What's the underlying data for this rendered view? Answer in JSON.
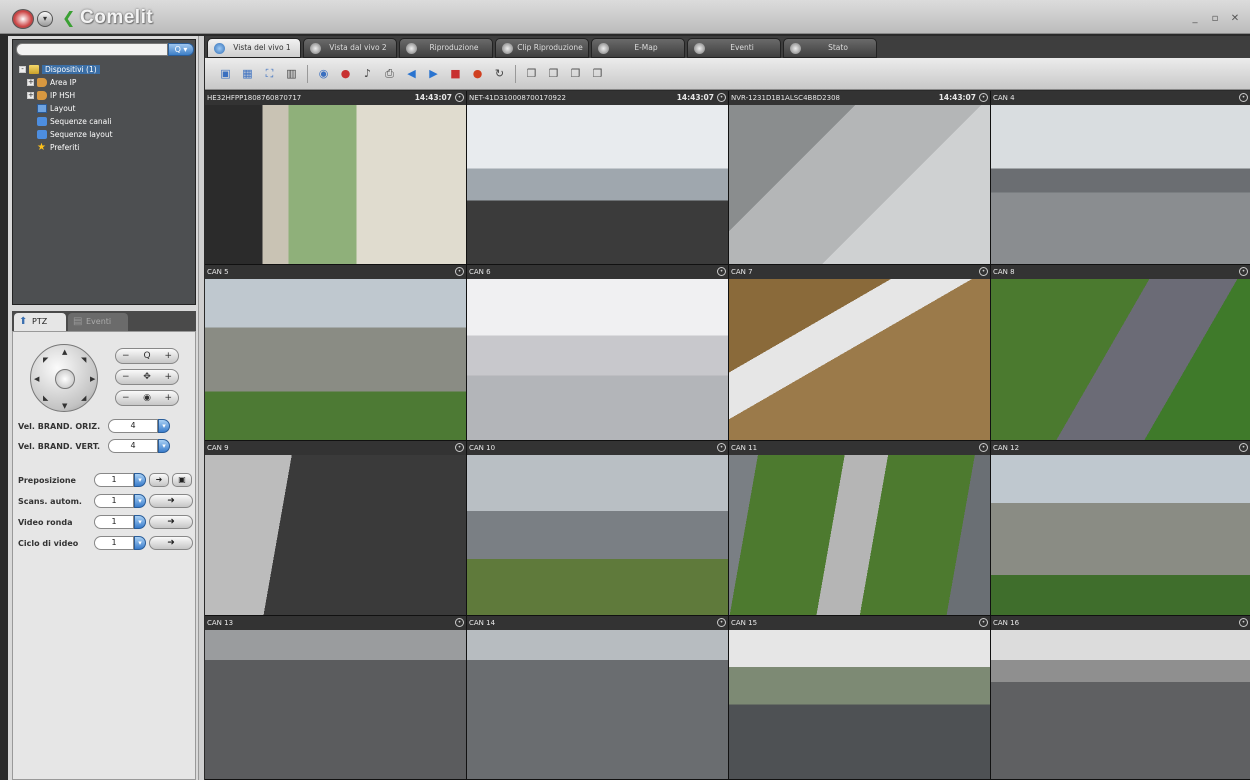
{
  "window": {
    "brand": "Comelit",
    "controls": [
      "_",
      "▫",
      "✕"
    ]
  },
  "search": {
    "placeholder": "",
    "button_label": "Q ▾"
  },
  "tree": [
    {
      "label": "Dispositivi (1)",
      "icon": "folder-icon",
      "expander": "-",
      "selected": true
    },
    {
      "label": "Area IP",
      "icon": "camera-icon",
      "expander": "+",
      "selected": false
    },
    {
      "label": "IP HSH",
      "icon": "camera-icon",
      "expander": "+",
      "selected": false
    },
    {
      "label": "Layout",
      "icon": "layout-icon",
      "expander": "",
      "selected": false
    },
    {
      "label": "Sequenze canali",
      "icon": "sequence-icon",
      "expander": "",
      "selected": false
    },
    {
      "label": "Sequenze layout",
      "icon": "sequence-icon",
      "expander": "",
      "selected": false
    },
    {
      "label": "Preferiti",
      "icon": "star-icon",
      "expander": "",
      "selected": false
    }
  ],
  "left_tabs": {
    "ptz": "PTZ",
    "events": "Eventi"
  },
  "ptz": {
    "zoom_stepper": {
      "minus": "−",
      "icon": "Q",
      "plus": "+"
    },
    "focus_stepper": {
      "minus": "−",
      "icon": "✥",
      "plus": "+"
    },
    "iris_stepper": {
      "minus": "−",
      "icon": "◉",
      "plus": "+"
    },
    "speed_horizontal_label": "Vel. BRAND. ORIZ.",
    "speed_horizontal_value": "4",
    "speed_vertical_label": "Vel. BRAND. VERT.",
    "speed_vertical_value": "4",
    "preset_label": "Preposizione",
    "preset_value": "1",
    "scan_label": "Scans. autom.",
    "scan_value": "1",
    "patrol_label": "Video ronda",
    "patrol_value": "1",
    "tour_label": "Ciclo di video",
    "tour_value": "1",
    "go_symbol": "➜",
    "save_symbol": "▣"
  },
  "tabs": [
    {
      "label": "Vista del vivo 1",
      "active": true
    },
    {
      "label": "Vista dal vivo 2",
      "active": false
    },
    {
      "label": "Riproduzione",
      "active": false
    },
    {
      "label": "Clip Riproduzione",
      "active": false
    },
    {
      "label": "E-Map",
      "active": false
    },
    {
      "label": "Eventi",
      "active": false
    },
    {
      "label": "Stato",
      "active": false
    }
  ],
  "toolbar_icons": [
    "layout-1-icon",
    "layout-4-icon",
    "fullscreen-icon",
    "layout-custom-icon",
    "sep",
    "start-all-icon",
    "record-icon",
    "audio-icon",
    "snapshot-icon",
    "prev-page-icon",
    "next-page-icon",
    "stop-all-icon",
    "alarm-icon",
    "refresh-icon",
    "sep",
    "capture-1-icon",
    "capture-2-icon",
    "capture-3-icon",
    "capture-4-icon"
  ],
  "cameras": [
    {
      "title": "HE32HFPP1808760870717",
      "time": "14:43:07"
    },
    {
      "title": "NET-41D310008700170922",
      "time": "14:43:07"
    },
    {
      "title": "NVR-1231D1B1ALSC4B8D2308",
      "time": "14:43:07"
    },
    {
      "title": "CAN 4",
      "time": ""
    },
    {
      "title": "CAN 5",
      "time": ""
    },
    {
      "title": "CAN 6",
      "time": ""
    },
    {
      "title": "CAN 7",
      "time": ""
    },
    {
      "title": "CAN 8",
      "time": ""
    },
    {
      "title": "CAN 9",
      "time": ""
    },
    {
      "title": "CAN 10",
      "time": ""
    },
    {
      "title": "CAN 11",
      "time": ""
    },
    {
      "title": "CAN 12",
      "time": ""
    },
    {
      "title": "CAN 13",
      "time": ""
    },
    {
      "title": "CAN 14",
      "time": ""
    },
    {
      "title": "CAN 15",
      "time": ""
    },
    {
      "title": "CAN 16",
      "time": ""
    }
  ],
  "selected_camera": 2,
  "colors": {
    "accent_blue": "#3a7ccb",
    "brand_green": "#3aa033",
    "selection_green": "#3fb23a"
  }
}
